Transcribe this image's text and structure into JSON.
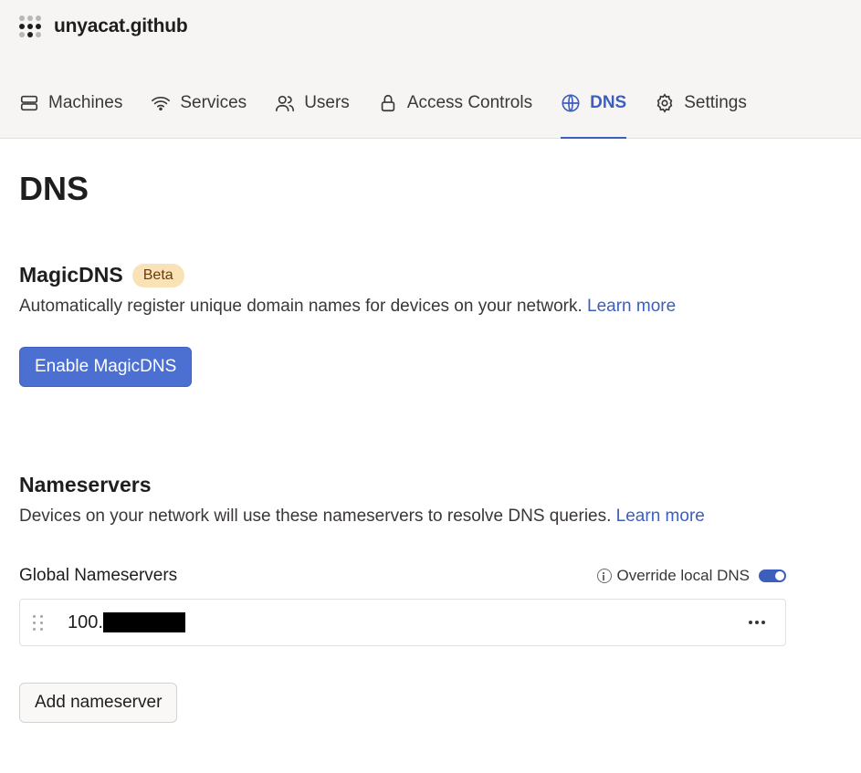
{
  "org": {
    "name": "unyacat.github"
  },
  "nav": {
    "tabs": [
      {
        "label": "Machines",
        "icon": "server-icon"
      },
      {
        "label": "Services",
        "icon": "wifi-icon"
      },
      {
        "label": "Users",
        "icon": "users-icon"
      },
      {
        "label": "Access Controls",
        "icon": "lock-icon"
      },
      {
        "label": "DNS",
        "icon": "globe-icon",
        "active": true
      },
      {
        "label": "Settings",
        "icon": "gear-icon"
      }
    ]
  },
  "page": {
    "title": "DNS"
  },
  "magicdns": {
    "title": "MagicDNS",
    "badge": "Beta",
    "description": "Automatically register unique domain names for devices on your network.",
    "learn_more": "Learn more",
    "button": "Enable MagicDNS"
  },
  "nameservers": {
    "title": "Nameservers",
    "description": "Devices on your network will use these nameservers to resolve DNS queries.",
    "learn_more": "Learn more",
    "global_label": "Global Nameservers",
    "override_label": "Override local DNS",
    "override_enabled": true,
    "entries": [
      {
        "ip_visible": "100."
      }
    ],
    "add_button": "Add nameserver"
  },
  "colors": {
    "accent": "#3c5fbd",
    "primary_button": "#4b70d1",
    "badge_bg": "#f9e2b6"
  }
}
